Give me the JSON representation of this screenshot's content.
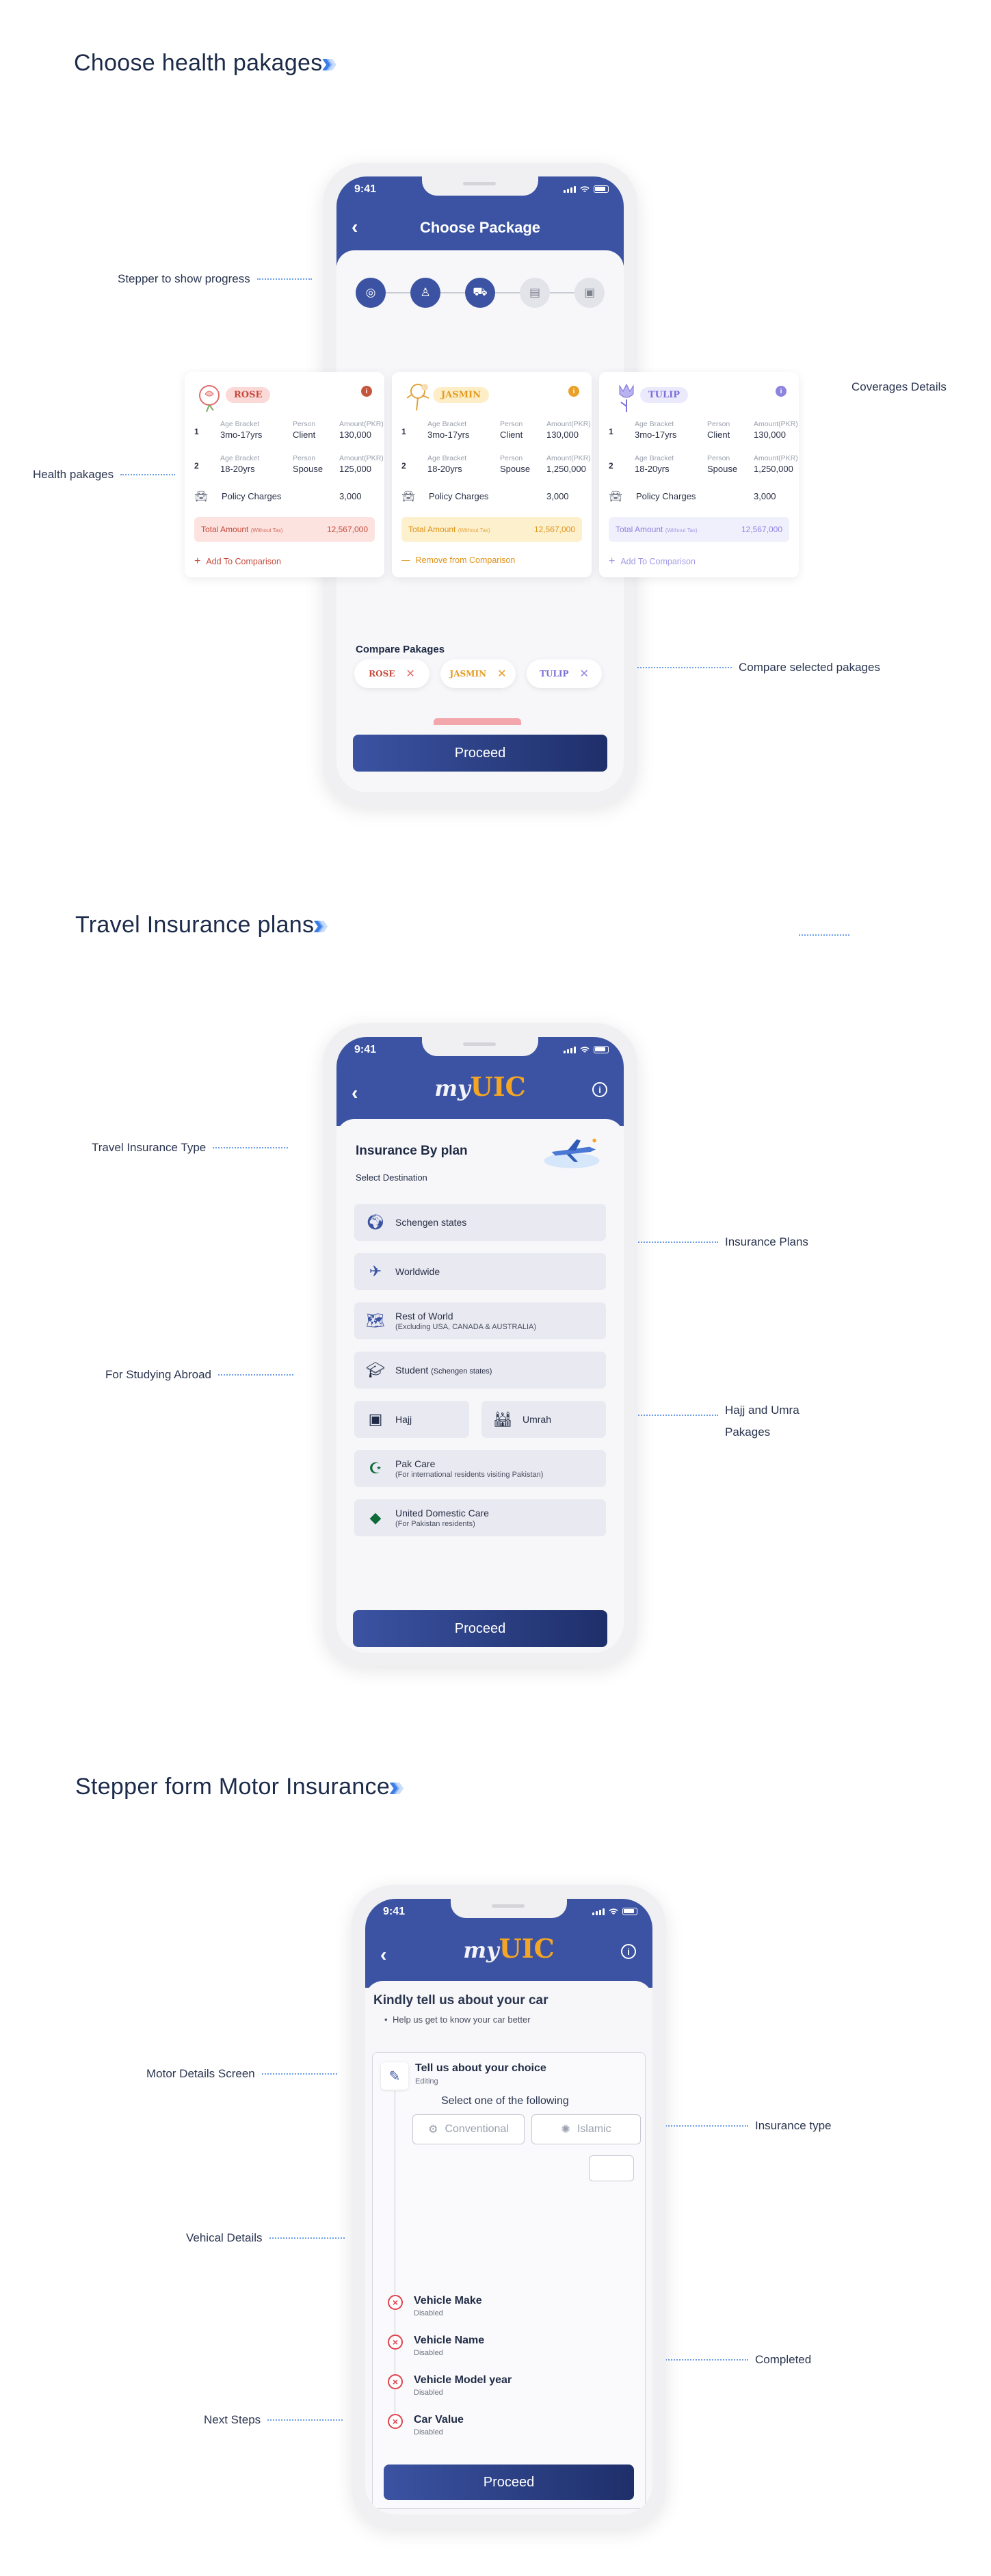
{
  "colors": {
    "primary": "#3b53a2",
    "primary_dark": "#1e2f6a",
    "accent": "#f5a524",
    "annot_line": "#6f9fe8",
    "disabled": "#e0434e"
  },
  "sections": {
    "health": {
      "title": "Choose health pakages"
    },
    "travel": {
      "title": "Travel Insurance plans"
    },
    "motor": {
      "title": "Stepper form Motor Insurance"
    }
  },
  "annotations": {
    "stepper": "Stepper to show progress",
    "coverages": "Coverages Details",
    "health_packages": "Health pakages",
    "compare": "Compare selected pakages",
    "travel_type": "Travel Insurance Type",
    "plans": "Insurance Plans",
    "studying": "For Studying Abroad",
    "hajj_line1": "Hajj and Umra",
    "hajj_line2": "Pakages",
    "motor_details": "Motor Details Screen",
    "insurance_type": "Insurance type",
    "vehical": "Vehical Details",
    "completed": "Completed",
    "next_steps": "Next Steps"
  },
  "phone": {
    "time": "9:41",
    "proceed": "Proceed"
  },
  "health_screen": {
    "title": "Choose Package",
    "steps": [
      {
        "icon": "globe-icon",
        "glyph": "◎",
        "state": "done"
      },
      {
        "icon": "user-icon",
        "glyph": "♙",
        "state": "done"
      },
      {
        "icon": "vehicle-icon",
        "glyph": "⛟",
        "state": "done"
      },
      {
        "icon": "document-icon",
        "glyph": "▤",
        "state": "todo"
      },
      {
        "icon": "wallet-icon",
        "glyph": "▣",
        "state": "todo"
      }
    ],
    "labels": {
      "age": "Age Bracket",
      "person": "Person",
      "amount": "Amount(PKR)",
      "policy": "Policy Charges",
      "total": "Total Amount",
      "without_tax": "(Without Tax)"
    },
    "packages": [
      {
        "name": "ROSE",
        "rows": [
          {
            "num": "1",
            "age": "3mo-17yrs",
            "person": "Client",
            "amount": "130,000"
          },
          {
            "num": "2",
            "age": "18-20yrs",
            "person": "Spouse",
            "amount": "125,000"
          }
        ],
        "policy": "3,000",
        "total": "12,567,000",
        "action": "Add To Comparison",
        "action_symbol": "+"
      },
      {
        "name": "JASMIN",
        "rows": [
          {
            "num": "1",
            "age": "3mo-17yrs",
            "person": "Client",
            "amount": "130,000"
          },
          {
            "num": "2",
            "age": "18-20yrs",
            "person": "Spouse",
            "amount": "1,250,000"
          }
        ],
        "policy": "3,000",
        "total": "12,567,000",
        "action": "Remove from Comparison",
        "action_symbol": "—"
      },
      {
        "name": "TULIP",
        "rows": [
          {
            "num": "1",
            "age": "3mo-17yrs",
            "person": "Client",
            "amount": "130,000"
          },
          {
            "num": "2",
            "age": "18-20yrs",
            "person": "Spouse",
            "amount": "1,250,000"
          }
        ],
        "policy": "3,000",
        "total": "12,567,000",
        "action": "Add To Comparison",
        "action_symbol": "+"
      }
    ],
    "compare_title": "Compare Pakages",
    "chips": [
      "ROSE",
      "JASMIN",
      "TULIP"
    ],
    "chip_close": "✕"
  },
  "travel_screen": {
    "logo_my": "my",
    "logo_uic": "UIC",
    "heading": "Insurance By plan",
    "subheading": "Select Destination",
    "options": {
      "schengen": "Schengen states",
      "worldwide": "Worldwide",
      "rest": "Rest of World",
      "rest_sub": "(Excluding USA, CANADA & AUSTRALIA)",
      "student": "Student",
      "student_sub": "(Schengen states)",
      "hajj": "Hajj",
      "umrah": "Umrah",
      "pak": "Pak Care",
      "pak_sub": "(For international residents visiting Pakistan)",
      "domestic": "United Domestic Care",
      "domestic_sub": "(For Pakistan residents)"
    }
  },
  "motor_screen": {
    "heading": "Kindly tell us about your car",
    "bullet": "Help us get to know your car better",
    "choice_title": "Tell us about your choice",
    "choice_state": "Editing",
    "select_label": "Select one of the following",
    "conventional": "Conventional",
    "islamic": "Islamic",
    "steps": [
      {
        "title": "Vehicle Make",
        "state": "Disabled"
      },
      {
        "title": "Vehicle Name",
        "state": "Disabled"
      },
      {
        "title": "Vehicle Model year",
        "state": "Disabled"
      },
      {
        "title": "Car Value",
        "state": "Disabled"
      }
    ]
  }
}
